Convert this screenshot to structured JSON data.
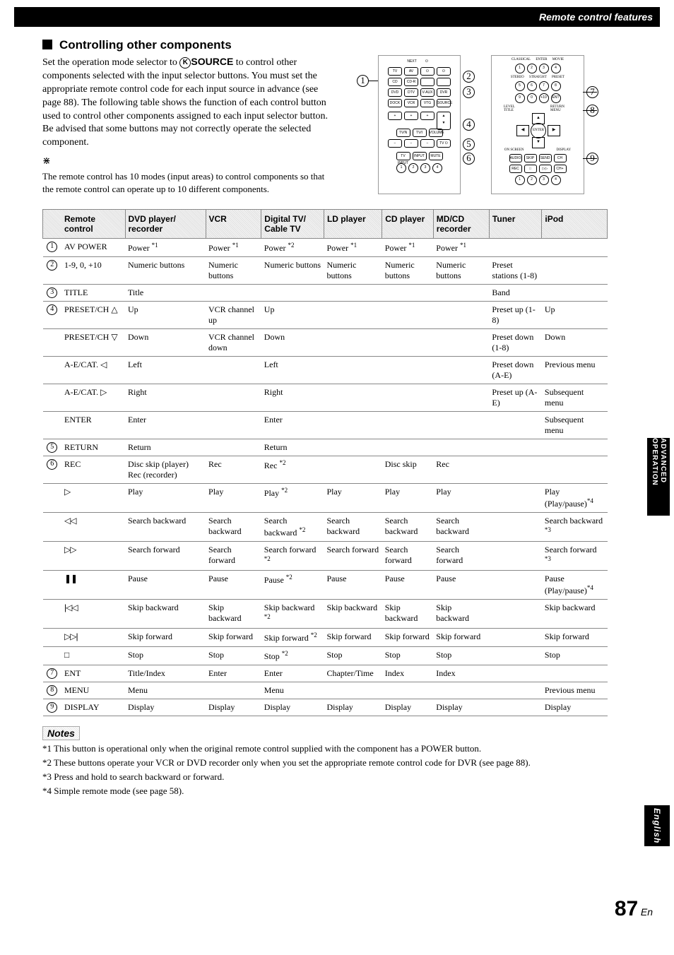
{
  "header_bar": "Remote control features",
  "heading": "Controlling other components",
  "intro_parts": {
    "p1a": "Set the operation mode selector to ",
    "source_letter": "K",
    "source_word": "SOURCE",
    "p1b": " to control other components selected with the input selector buttons. You must set the appropriate remote control code for each input source in advance (see page 88). The following table shows the function of each control button used to control other components assigned to each input selector button. Be advised that some buttons may not correctly operate the selected component."
  },
  "tip": "The remote control has 10 modes (input areas) to control components so that the remote control can operate up to 10 different components.",
  "table": {
    "headers": [
      "Remote control",
      "DVD player/ recorder",
      "VCR",
      "Digital TV/ Cable TV",
      "LD player",
      "CD player",
      "MD/CD recorder",
      "Tuner",
      "iPod"
    ],
    "rows": [
      {
        "num": "1",
        "cells": [
          "AV POWER",
          "Power *1",
          "Power *1",
          "Power *2",
          "Power *1",
          "Power *1",
          "Power *1",
          "",
          ""
        ]
      },
      {
        "num": "2",
        "cells": [
          "1-9, 0, +10",
          "Numeric buttons",
          "Numeric buttons",
          "Numeric buttons",
          "Numeric buttons",
          "Numeric buttons",
          "Numeric buttons",
          "Preset stations (1-8)",
          ""
        ]
      },
      {
        "num": "3",
        "cells": [
          "TITLE",
          "Title",
          "",
          "",
          "",
          "",
          "",
          "Band",
          ""
        ]
      },
      {
        "num": "4",
        "cells": [
          "PRESET/CH △",
          "Up",
          "VCR channel up",
          "Up",
          "",
          "",
          "",
          "Preset up (1-8)",
          "Up"
        ]
      },
      {
        "num": "",
        "cells": [
          "PRESET/CH ▽",
          "Down",
          "VCR channel down",
          "Down",
          "",
          "",
          "",
          "Preset down (1-8)",
          "Down"
        ]
      },
      {
        "num": "",
        "cells": [
          "A-E/CAT. ◁",
          "Left",
          "",
          "Left",
          "",
          "",
          "",
          "Preset down (A-E)",
          "Previous menu"
        ]
      },
      {
        "num": "",
        "cells": [
          "A-E/CAT. ▷",
          "Right",
          "",
          "Right",
          "",
          "",
          "",
          "Preset up (A-E)",
          "Subsequent menu"
        ]
      },
      {
        "num": "",
        "cells": [
          "ENTER",
          "Enter",
          "",
          "Enter",
          "",
          "",
          "",
          "",
          "Subsequent menu"
        ]
      },
      {
        "num": "5",
        "cells": [
          "RETURN",
          "Return",
          "",
          "Return",
          "",
          "",
          "",
          "",
          ""
        ]
      },
      {
        "num": "6",
        "cells": [
          "REC",
          "Disc skip (player) Rec (recorder)",
          "Rec",
          "Rec *2",
          "",
          "Disc skip",
          "Rec",
          "",
          ""
        ]
      },
      {
        "num": "",
        "sym": "play",
        "cells": [
          "",
          "Play",
          "Play",
          "Play *2",
          "Play",
          "Play",
          "Play",
          "",
          "Play (Play/pause)*4"
        ]
      },
      {
        "num": "",
        "sym": "rew",
        "cells": [
          "",
          "Search backward",
          "Search backward",
          "Search backward *2",
          "Search backward",
          "Search backward",
          "Search backward",
          "",
          "Search backward *3"
        ]
      },
      {
        "num": "",
        "sym": "ff",
        "cells": [
          "",
          "Search forward",
          "Search forward",
          "Search forward *2",
          "Search forward",
          "Search forward",
          "Search forward",
          "",
          "Search forward *3"
        ]
      },
      {
        "num": "",
        "sym": "pause",
        "cells": [
          "",
          "Pause",
          "Pause",
          "Pause *2",
          "Pause",
          "Pause",
          "Pause",
          "",
          "Pause (Play/pause)*4"
        ]
      },
      {
        "num": "",
        "sym": "skipb",
        "cells": [
          "",
          "Skip backward",
          "Skip backward",
          "Skip backward *2",
          "Skip backward",
          "Skip backward",
          "Skip backward",
          "",
          "Skip backward"
        ]
      },
      {
        "num": "",
        "sym": "skipf",
        "cells": [
          "",
          "Skip forward",
          "Skip forward",
          "Skip forward *2",
          "Skip forward",
          "Skip forward",
          "Skip forward",
          "",
          "Skip forward"
        ]
      },
      {
        "num": "",
        "sym": "stop",
        "cells": [
          "",
          "Stop",
          "Stop",
          "Stop *2",
          "Stop",
          "Stop",
          "Stop",
          "",
          "Stop"
        ]
      },
      {
        "num": "7",
        "cells": [
          "ENT",
          "Title/Index",
          "Enter",
          "Enter",
          "Chapter/Time",
          "Index",
          "Index",
          "",
          ""
        ]
      },
      {
        "num": "8",
        "cells": [
          "MENU",
          "Menu",
          "",
          "Menu",
          "",
          "",
          "",
          "",
          "Previous menu"
        ]
      },
      {
        "num": "9",
        "cells": [
          "DISPLAY",
          "Display",
          "Display",
          "Display",
          "Display",
          "Display",
          "Display",
          "",
          "Display"
        ]
      }
    ]
  },
  "notes_title": "Notes",
  "notes": [
    "*1 This button is operational only when the original remote control supplied with the component has a POWER button.",
    "*2 These buttons operate your VCR or DVD recorder only when you set the appropriate remote control code for DVR (see page 88).",
    "*3 Press and hold to search backward or forward.",
    "*4 Simple remote mode (see page 58)."
  ],
  "side_ops": "ADVANCED OPERATION",
  "side_english": "English",
  "page_number": "87",
  "page_lang": "En",
  "callouts_left": [
    "1"
  ],
  "callouts_mid": [
    "2",
    "3",
    "4",
    "5",
    "6"
  ],
  "callouts_right": [
    "7",
    "8",
    "9"
  ],
  "symbols": {
    "play": "▷",
    "rew": "◁◁",
    "ff": "▷▷",
    "pause": "❚❚",
    "skipb": "|◁◁",
    "skipf": "▷▷|",
    "stop": "□"
  }
}
